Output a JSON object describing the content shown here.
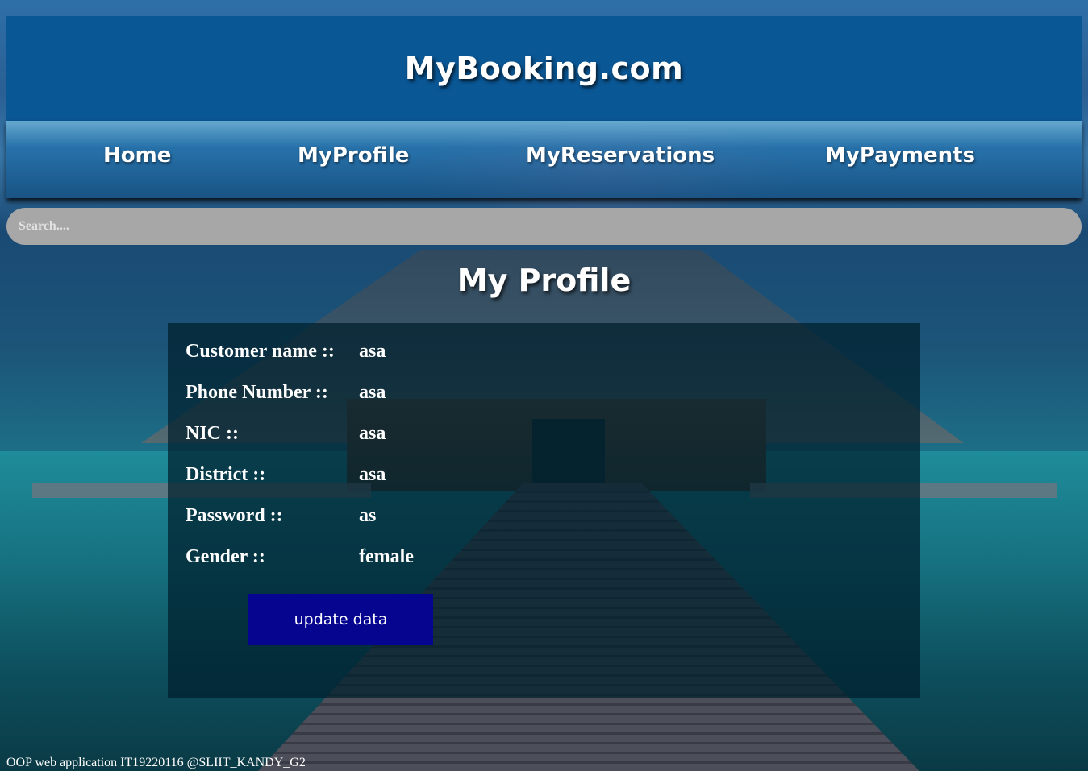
{
  "header": {
    "title": "MyBooking.com"
  },
  "nav": {
    "items": [
      {
        "label": "Home"
      },
      {
        "label": "MyProfile"
      },
      {
        "label": "MyReservations"
      },
      {
        "label": "MyPayments"
      }
    ]
  },
  "search": {
    "placeholder": "Search....",
    "value": ""
  },
  "page": {
    "title": "My Profile"
  },
  "profile": {
    "fields": [
      {
        "label": "Customer name ::",
        "value": "asa"
      },
      {
        "label": "Phone Number ::",
        "value": "asa"
      },
      {
        "label": "NIC ::",
        "value": "asa"
      },
      {
        "label": "District ::",
        "value": "asa"
      },
      {
        "label": "Password ::",
        "value": "as"
      },
      {
        "label": "Gender ::",
        "value": "female"
      }
    ],
    "update_label": "update data"
  },
  "footer": {
    "text": "OOP web application IT19220116 @SLIIT_KANDY_G2"
  },
  "colors": {
    "header_bg": "#0a5795",
    "button_bg": "#05058f",
    "search_bg": "#a7a7a7"
  }
}
